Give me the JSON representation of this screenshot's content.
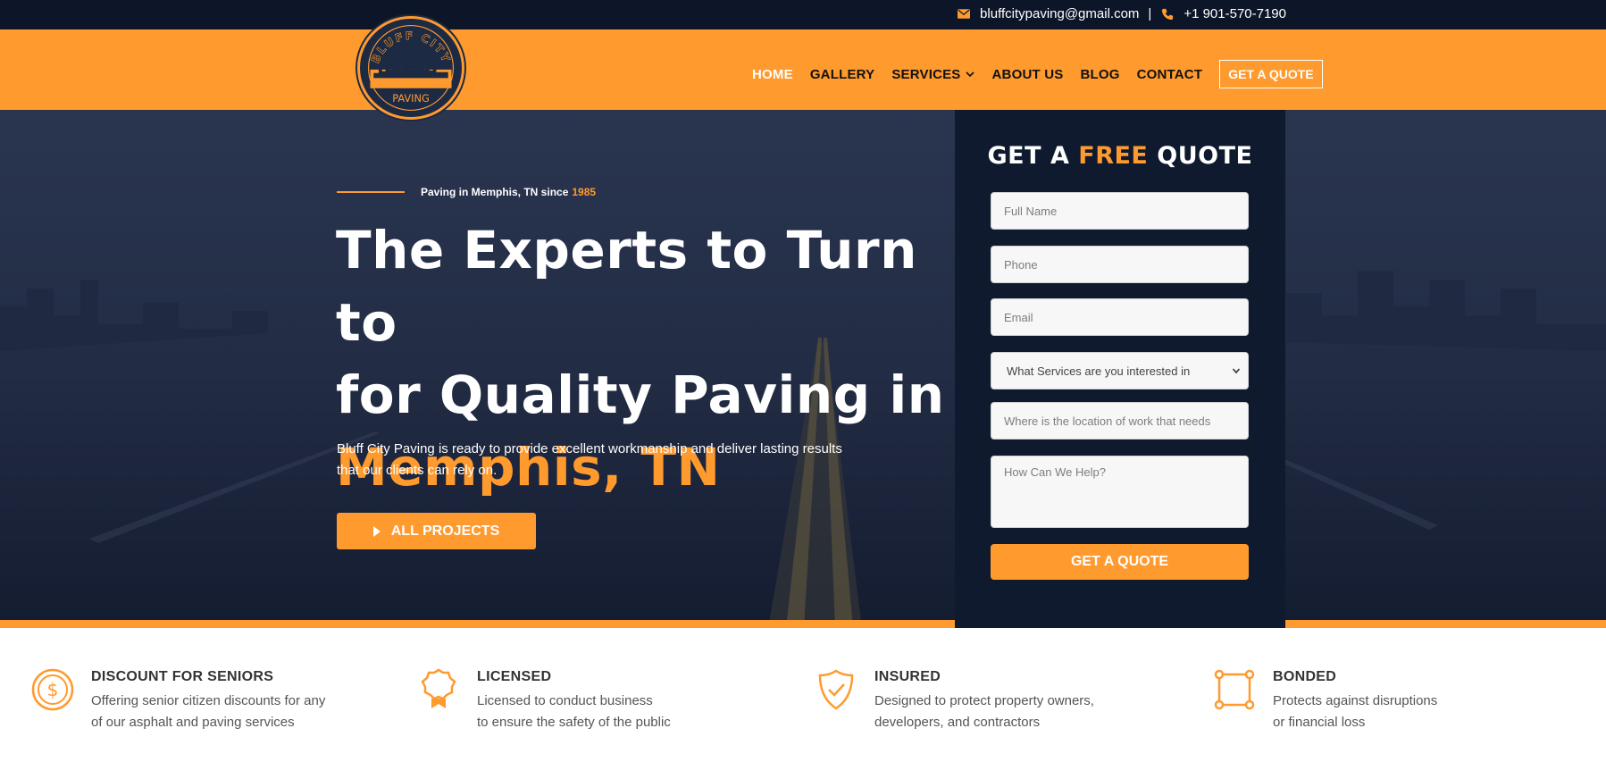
{
  "topbar": {
    "email": "bluffcitypaving@gmail.com",
    "separator": "|",
    "phone": "+1 901-570-7190",
    "email_icon": "envelope-icon",
    "phone_icon": "phone-icon"
  },
  "logo": {
    "top_text": "BLUFF CITY",
    "bottom_text": "PAVING"
  },
  "nav": {
    "items": [
      {
        "label": "HOME"
      },
      {
        "label": "GALLERY"
      },
      {
        "label": "SERVICES"
      },
      {
        "label": "ABOUT US"
      },
      {
        "label": "BLOG"
      },
      {
        "label": "CONTACT"
      }
    ],
    "quote_label": "GET A QUOTE"
  },
  "hero": {
    "tagline": "Paving in Memphis, TN since",
    "tagline_year": "1985",
    "headline_line1": "The Experts to Turn to",
    "headline_line2": "for Quality Paving in",
    "headline_accent": "Memphis, TN",
    "subtext": "Bluff City Paving is ready to provide excellent workmanship and deliver lasting results that our clients can rely on.",
    "button_label": "ALL PROJECTS"
  },
  "form": {
    "title_pre": "GET A",
    "title_accent": "FREE",
    "title_post": "QUOTE",
    "name_placeholder": "Full Name",
    "phone_placeholder": "Phone",
    "email_placeholder": "Email",
    "service_select": "What Services are you interested in",
    "location_placeholder": "Where is the location of work that needs",
    "help_placeholder": "How Can We Help?",
    "submit_label": "GET A QUOTE"
  },
  "features": [
    {
      "icon": "dollar-coin-icon",
      "title": "DISCOUNT FOR SENIORS",
      "line1": "Offering senior citizen discounts for any",
      "line2": "of our asphalt and paving services"
    },
    {
      "icon": "award-badge-icon",
      "title": "LICENSED",
      "line1": "Licensed to conduct business",
      "line2": "to ensure the safety of the public"
    },
    {
      "icon": "shield-check-icon",
      "title": "INSURED",
      "line1": "Designed to protect property owners,",
      "line2": "developers, and contractors"
    },
    {
      "icon": "bonded-square-icon",
      "title": "BONDED",
      "line1": "Protects against disruptions",
      "line2": "or financial loss"
    }
  ],
  "colors": {
    "accent": "#ff9a2e",
    "navy": "#0d1628"
  }
}
